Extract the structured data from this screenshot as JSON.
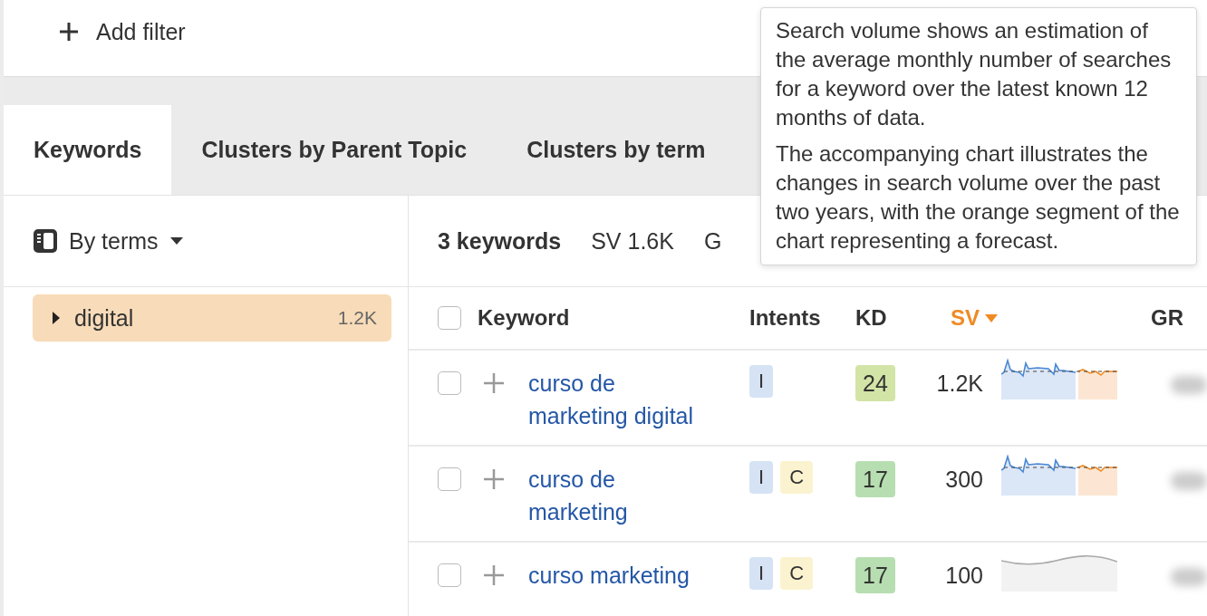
{
  "filter_bar": {
    "add_filter": "Add filter"
  },
  "tabs": [
    {
      "label": "Keywords",
      "selected": true
    },
    {
      "label": "Clusters by Parent Topic",
      "selected": false
    },
    {
      "label": "Clusters by term",
      "selected": false
    }
  ],
  "grouping": {
    "label": "By terms"
  },
  "terms": [
    {
      "term": "digital",
      "count": "1.2K",
      "selected": true,
      "expanded": false
    }
  ],
  "summary": {
    "count": "3 keywords",
    "sv": "SV 1.6K",
    "column_3": "G"
  },
  "table": {
    "select_all": {
      "checked": false
    },
    "columns": [
      {
        "label": "Keyword",
        "sorted": false
      },
      {
        "label": "Intents",
        "sorted": false
      },
      {
        "label": "KD",
        "sorted": false
      },
      {
        "label": "SV",
        "sorted": true
      },
      {
        "label": "GR",
        "sorted": false
      }
    ],
    "rows": [
      {
        "keyword": "curso de marketing digital",
        "checked": false,
        "intents": [
          {
            "label": "I",
            "color": "#d5e3f4"
          }
        ],
        "kd": {
          "value": "24",
          "color": "#d3e4a7"
        },
        "sv": "1.2K",
        "trend": {
          "kind": "forecast"
        }
      },
      {
        "keyword": "curso de marketing",
        "checked": false,
        "intents": [
          {
            "label": "I",
            "color": "#d5e3f4"
          },
          {
            "label": "C",
            "color": "#fbf3cf"
          }
        ],
        "kd": {
          "value": "17",
          "color": "#b7deb1"
        },
        "sv": "300",
        "trend": {
          "kind": "forecast"
        }
      },
      {
        "keyword": "curso marketing",
        "checked": false,
        "intents": [
          {
            "label": "I",
            "color": "#d5e3f4"
          },
          {
            "label": "C",
            "color": "#fbf3cf"
          }
        ],
        "kd": {
          "value": "17",
          "color": "#b7deb1"
        },
        "sv": "100",
        "trend": {
          "kind": "smooth"
        }
      }
    ]
  },
  "tooltip": {
    "paragraphs": [
      "Search volume shows an estimation of the average monthly number of searches for a keyword over the latest known 12 months of data.",
      "The accompanying chart illustrates the changes in search volume over the past two years, with the orange segment of the chart representing a forecast."
    ]
  }
}
